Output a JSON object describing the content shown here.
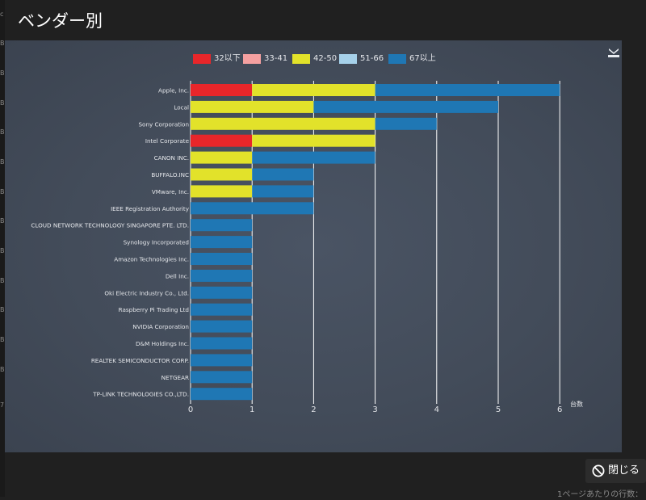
{
  "modal": {
    "title": "ベンダー別",
    "close_label": "閉じる",
    "paging_text": "1ページあたりの行数："
  },
  "chart_data": {
    "type": "bar",
    "orientation": "horizontal",
    "stacked": true,
    "categories": [
      "Apple, Inc.",
      "Local",
      "Sony Corporation",
      "Intel Corporate",
      "CANON INC.",
      "BUFFALO.INC",
      "VMware, Inc.",
      "IEEE Registration Authority",
      "CLOUD NETWORK TECHNOLOGY SINGAPORE PTE. LTD.",
      "Synology Incorporated",
      "Amazon Technologies Inc.",
      "Dell Inc.",
      "Oki Electric Industry Co., Ltd.",
      "Raspberry Pi Trading Ltd",
      "NVIDIA Corporation",
      "D&M Holdings Inc.",
      "REALTEK SEMICONDUCTOR CORP.",
      "NETGEAR",
      "TP-LINK TECHNOLOGIES CO.,LTD."
    ],
    "series": [
      {
        "name": "32以下",
        "color": "#e8262a",
        "values": [
          1,
          0,
          0,
          1,
          0,
          0,
          0,
          0,
          0,
          0,
          0,
          0,
          0,
          0,
          0,
          0,
          0,
          0,
          0
        ]
      },
      {
        "name": "33-41",
        "color": "#f5a0a0",
        "values": [
          0,
          0,
          0,
          0,
          0,
          0,
          0,
          0,
          0,
          0,
          0,
          0,
          0,
          0,
          0,
          0,
          0,
          0,
          0
        ]
      },
      {
        "name": "42-50",
        "color": "#e2e22a",
        "values": [
          2,
          2,
          3,
          2,
          1,
          1,
          1,
          0,
          0,
          0,
          0,
          0,
          0,
          0,
          0,
          0,
          0,
          0,
          0
        ]
      },
      {
        "name": "51-66",
        "color": "#a6d1ea",
        "values": [
          0,
          0,
          0,
          0,
          0,
          0,
          0,
          0,
          0,
          0,
          0,
          0,
          0,
          0,
          0,
          0,
          0,
          0,
          0
        ]
      },
      {
        "name": "67以上",
        "color": "#1f77b4",
        "values": [
          3,
          3,
          1,
          0,
          2,
          1,
          1,
          2,
          1,
          1,
          1,
          1,
          1,
          1,
          1,
          1,
          1,
          1,
          1
        ]
      }
    ],
    "xlabel": "台数",
    "xlim": [
      0,
      6
    ],
    "xticks": [
      "0",
      "1",
      "2",
      "3",
      "4",
      "5",
      "6"
    ],
    "grid": true,
    "legend_position": "top"
  },
  "colors": {
    "tick_text": "#e4e6ea",
    "grid": "#ffffff"
  },
  "icons": {
    "download": "download-icon",
    "close": "prohibited-icon"
  }
}
